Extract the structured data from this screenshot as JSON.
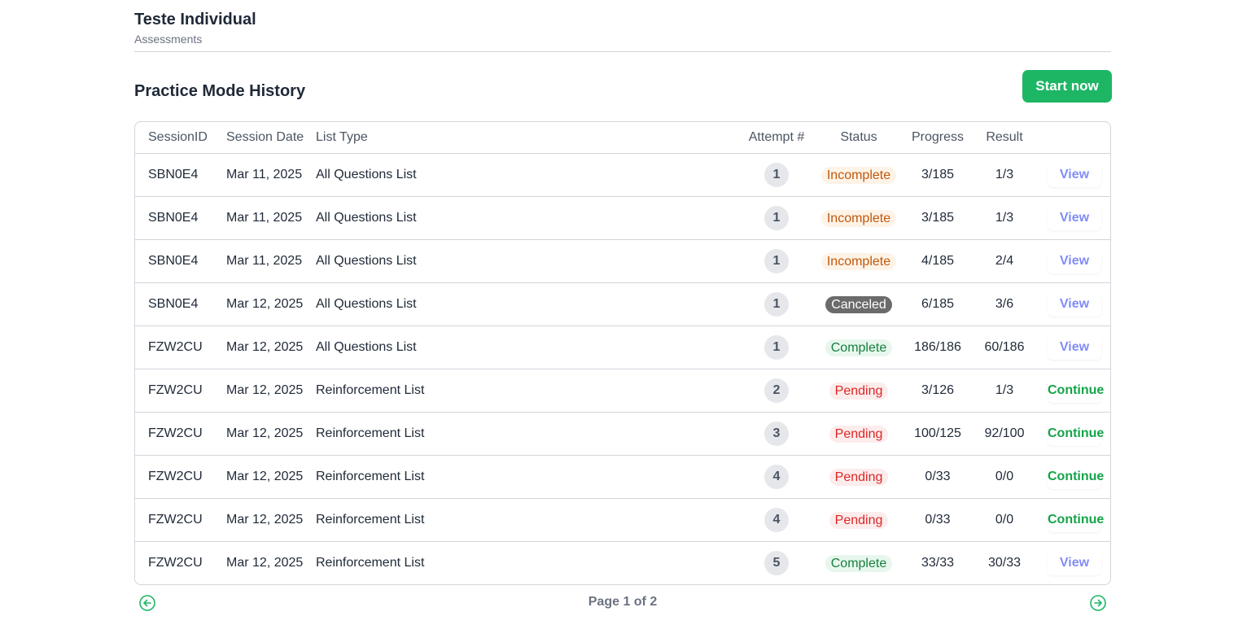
{
  "header": {
    "title": "Teste Individual",
    "subtitle": "Assessments"
  },
  "section": {
    "title": "Practice Mode History",
    "start_button": "Start now"
  },
  "colors": {
    "accent_green": "#1db665",
    "view_link": "#818cf8",
    "continue_link": "#16a34a"
  },
  "table": {
    "columns": [
      "SessionID",
      "Session Date",
      "List Type",
      "Attempt #",
      "Status",
      "Progress",
      "Result",
      ""
    ],
    "rows": [
      {
        "session_id": "SBN0E4",
        "date": "Mar 11, 2025",
        "list_type": "All Questions List",
        "attempt": "1",
        "status": "Incomplete",
        "status_kind": "incomplete",
        "progress": "3/185",
        "result": "1/3",
        "action": "View",
        "action_kind": "view"
      },
      {
        "session_id": "SBN0E4",
        "date": "Mar 11, 2025",
        "list_type": "All Questions List",
        "attempt": "1",
        "status": "Incomplete",
        "status_kind": "incomplete",
        "progress": "3/185",
        "result": "1/3",
        "action": "View",
        "action_kind": "view"
      },
      {
        "session_id": "SBN0E4",
        "date": "Mar 11, 2025",
        "list_type": "All Questions List",
        "attempt": "1",
        "status": "Incomplete",
        "status_kind": "incomplete",
        "progress": "4/185",
        "result": "2/4",
        "action": "View",
        "action_kind": "view"
      },
      {
        "session_id": "SBN0E4",
        "date": "Mar 12, 2025",
        "list_type": "All Questions List",
        "attempt": "1",
        "status": "Canceled",
        "status_kind": "canceled",
        "progress": "6/185",
        "result": "3/6",
        "action": "View",
        "action_kind": "view"
      },
      {
        "session_id": "FZW2CU",
        "date": "Mar 12, 2025",
        "list_type": "All Questions List",
        "attempt": "1",
        "status": "Complete",
        "status_kind": "complete",
        "progress": "186/186",
        "result": "60/186",
        "action": "View",
        "action_kind": "view"
      },
      {
        "session_id": "FZW2CU",
        "date": "Mar 12, 2025",
        "list_type": "Reinforcement List",
        "attempt": "2",
        "status": "Pending",
        "status_kind": "pending",
        "progress": "3/126",
        "result": "1/3",
        "action": "Continue",
        "action_kind": "continue"
      },
      {
        "session_id": "FZW2CU",
        "date": "Mar 12, 2025",
        "list_type": "Reinforcement List",
        "attempt": "3",
        "status": "Pending",
        "status_kind": "pending",
        "progress": "100/125",
        "result": "92/100",
        "action": "Continue",
        "action_kind": "continue"
      },
      {
        "session_id": "FZW2CU",
        "date": "Mar 12, 2025",
        "list_type": "Reinforcement List",
        "attempt": "4",
        "status": "Pending",
        "status_kind": "pending",
        "progress": "0/33",
        "result": "0/0",
        "action": "Continue",
        "action_kind": "continue"
      },
      {
        "session_id": "FZW2CU",
        "date": "Mar 12, 2025",
        "list_type": "Reinforcement List",
        "attempt": "4",
        "status": "Pending",
        "status_kind": "pending",
        "progress": "0/33",
        "result": "0/0",
        "action": "Continue",
        "action_kind": "continue"
      },
      {
        "session_id": "FZW2CU",
        "date": "Mar 12, 2025",
        "list_type": "Reinforcement List",
        "attempt": "5",
        "status": "Complete",
        "status_kind": "complete",
        "progress": "33/33",
        "result": "30/33",
        "action": "View",
        "action_kind": "view"
      }
    ]
  },
  "pagination": {
    "label": "Page 1 of 2",
    "prev_icon": "arrow-left-circle-icon",
    "next_icon": "arrow-right-circle-icon"
  }
}
